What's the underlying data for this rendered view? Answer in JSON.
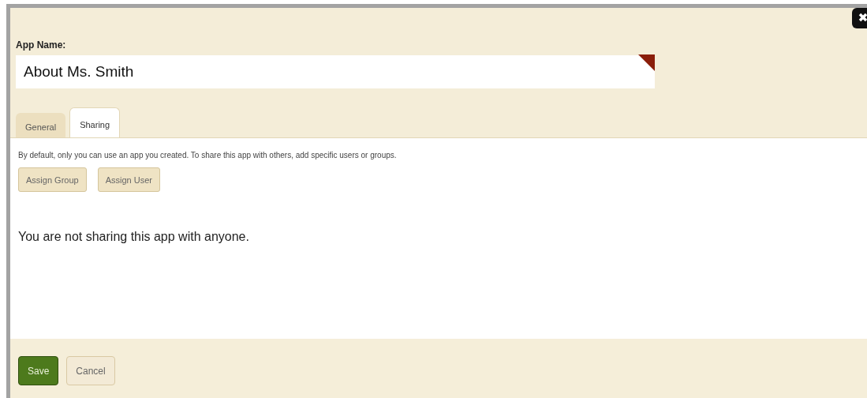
{
  "app_name": {
    "label": "App Name:",
    "value": "About Ms. Smith",
    "required": true
  },
  "tabs": [
    {
      "label": "General",
      "selected": false
    },
    {
      "label": "Sharing",
      "selected": true
    }
  ],
  "sharing": {
    "description": "By default, only you can use an app you created. To share this app with others, add specific users or groups.",
    "buttons": [
      "Assign Group",
      "Assign User"
    ],
    "empty_message": "You are not sharing this app with anyone."
  },
  "footer": {
    "buttons": [
      {
        "label": "Save",
        "kind": "primary"
      },
      {
        "label": "Cancel",
        "kind": "secondary"
      }
    ]
  }
}
